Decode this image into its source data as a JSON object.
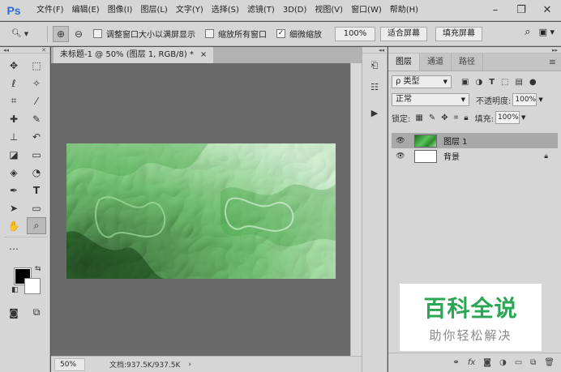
{
  "app": {
    "logo": "Ps"
  },
  "menu": [
    "文件(F)",
    "编辑(E)",
    "图像(I)",
    "图层(L)",
    "文字(Y)",
    "选择(S)",
    "滤镜(T)",
    "3D(D)",
    "视图(V)",
    "窗口(W)",
    "帮助(H)"
  ],
  "options": {
    "resize_windows": "调整窗口大小以满屏显示",
    "zoom_all": "缩放所有窗口",
    "scrubby_zoom": "细微缩放",
    "zoom_value": "100%",
    "fit_screen": "适合屏幕",
    "fill_screen": "填充屏幕",
    "checked": {
      "resize_windows": false,
      "zoom_all": false,
      "scrubby_zoom": true
    }
  },
  "document": {
    "tab_title": "未标题-1 @ 50% (图层 1, RGB/8) *",
    "tab_close": "×",
    "status_zoom": "50%",
    "status_doc": "文档:937.5K/937.5K",
    "status_arrow": "›"
  },
  "layers_panel": {
    "tabs": [
      "图层",
      "通道",
      "路径"
    ],
    "filter_kind": "ρ 类型",
    "blend_mode": "正常",
    "opacity_label": "不透明度:",
    "opacity_value": "100%",
    "lock_label": "锁定:",
    "fill_label": "填充:",
    "fill_value": "100%",
    "layers": [
      {
        "name": "图层 1",
        "visible": true,
        "selected": true
      },
      {
        "name": "背景",
        "visible": true,
        "selected": false,
        "locked": true
      }
    ],
    "footer_icons": [
      "link-icon",
      "fx-icon",
      "mask-icon",
      "adjustment-icon",
      "group-icon",
      "new-layer-icon",
      "trash-icon"
    ]
  },
  "watermark": {
    "title": "百科全说",
    "subtitle": "助你轻松解决"
  },
  "colors": {
    "canvas_green_dark": "#0e3d0e",
    "canvas_green_light": "#c8efc8",
    "watermark_green": "#2aa654"
  }
}
